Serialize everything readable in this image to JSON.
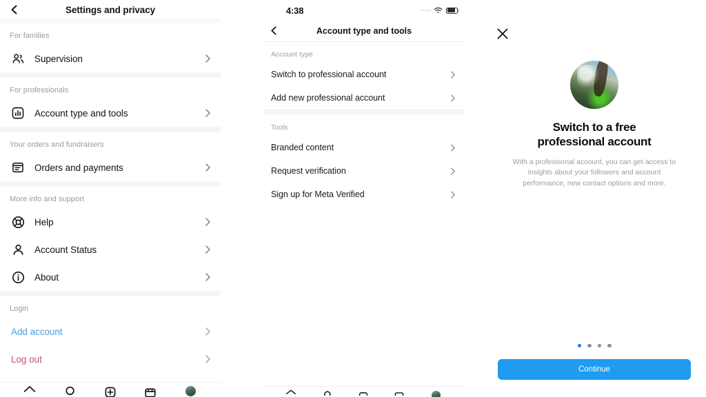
{
  "left_panel": {
    "header": {
      "title": "Settings and privacy",
      "back_icon": "chevron-left-icon"
    },
    "sections": [
      {
        "label": "For families",
        "items": [
          {
            "label": "Supervision",
            "icon": "people-supervision-icon",
            "style": "default"
          }
        ]
      },
      {
        "label": "For professionals",
        "items": [
          {
            "label": "Account type and tools",
            "icon": "bar-chart-square-icon",
            "style": "default"
          }
        ]
      },
      {
        "label": "Your orders and fundraisers",
        "items": [
          {
            "label": "Orders and payments",
            "icon": "receipt-box-icon",
            "style": "default"
          }
        ]
      },
      {
        "label": "More info and support",
        "items": [
          {
            "label": "Help",
            "icon": "lifebuoy-icon",
            "style": "default"
          },
          {
            "label": "Account Status",
            "icon": "person-icon",
            "style": "default"
          },
          {
            "label": "About",
            "icon": "info-circle-icon",
            "style": "default"
          }
        ]
      },
      {
        "label": "Login",
        "items": [
          {
            "label": "Add account",
            "icon": "",
            "style": "blue"
          },
          {
            "label": "Log out",
            "icon": "",
            "style": "red"
          }
        ]
      }
    ],
    "bottom_nav": [
      {
        "icon": "home-icon"
      },
      {
        "icon": "search-icon"
      },
      {
        "icon": "create-plus-icon"
      },
      {
        "icon": "reels-shop-icon"
      },
      {
        "icon": "profile-avatar-icon"
      }
    ]
  },
  "mid_panel": {
    "status_bar": {
      "time": "4:38",
      "signal_icon": "signal-dots-icon",
      "wifi_icon": "wifi-icon",
      "battery_icon": "battery-icon"
    },
    "header": {
      "title": "Account type and tools",
      "back_icon": "chevron-left-icon"
    },
    "sections": [
      {
        "label": "Account type",
        "items": [
          {
            "label": "Switch to professional account"
          },
          {
            "label": "Add new professional account"
          }
        ]
      },
      {
        "label": "Tools",
        "items": [
          {
            "label": "Branded content"
          },
          {
            "label": "Request verification"
          },
          {
            "label": "Sign up for Meta Verified"
          }
        ]
      }
    ],
    "bottom_nav": [
      {
        "icon": "home-icon"
      },
      {
        "icon": "search-icon"
      },
      {
        "icon": "create-plus-icon"
      },
      {
        "icon": "reels-shop-icon"
      },
      {
        "icon": "profile-avatar-icon"
      }
    ]
  },
  "right_panel": {
    "close_icon": "close-x-icon",
    "avatar": "profile-photo-nature",
    "title": "Switch to a free\nprofessional account",
    "title_line1": "Switch to a free",
    "title_line2": "professional account",
    "description": "With a professional account, you can get access to insights about your followers and account performance, new contact options and more.",
    "pagination": {
      "total": 4,
      "active_index": 0
    },
    "cta_label": "Continue",
    "colors": {
      "cta_background": "#1f9bf0",
      "dot_active": "#1877f2",
      "dot_inactive": "#8e8e8e"
    }
  },
  "theme": {
    "link_blue": "#4a9fd8",
    "danger_red": "#c6546a",
    "text_primary": "#111111",
    "text_muted": "#9a9a9a",
    "divider": "#f0f0f0",
    "section_gap": "#f5f5f5"
  }
}
